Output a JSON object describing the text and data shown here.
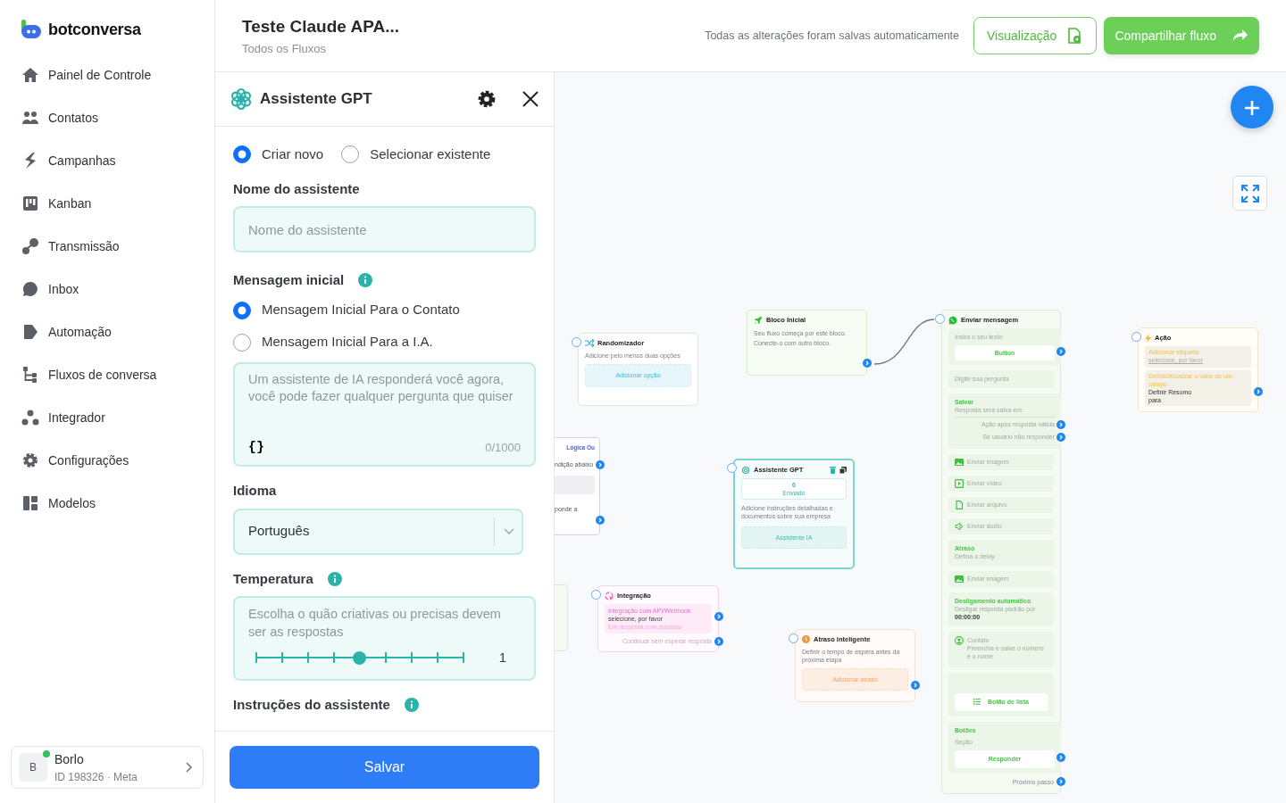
{
  "brand": {
    "name": "botconversa"
  },
  "sidebar": {
    "items": [
      {
        "label": "Painel de Controle"
      },
      {
        "label": "Contatos"
      },
      {
        "label": "Campanhas"
      },
      {
        "label": "Kanban"
      },
      {
        "label": "Transmissão"
      },
      {
        "label": "Inbox"
      },
      {
        "label": "Automação"
      },
      {
        "label": "Fluxos de conversa"
      },
      {
        "label": "Integrador"
      },
      {
        "label": "Configurações"
      },
      {
        "label": "Modelos"
      }
    ]
  },
  "user": {
    "initial": "B",
    "name": "Borlo",
    "meta": "ID 198326 · Meta",
    "online": true
  },
  "header": {
    "title": "Teste Claude APA...",
    "subtitle": "Todos os Fluxos",
    "save_status": "Todas as alterações foram salvas automaticamente",
    "buttons": [
      {
        "label": "Visualização",
        "kind": "outline"
      },
      {
        "label": "Compartilhar fluxo",
        "kind": "primary"
      }
    ]
  },
  "panel": {
    "title": "Assistente GPT",
    "mode_options": [
      {
        "label": "Criar novo",
        "selected": true
      },
      {
        "label": "Selecionar existente",
        "selected": false
      }
    ],
    "name_field": {
      "label": "Nome do assistente",
      "placeholder": "Nome do assistente"
    },
    "initial_message": {
      "label": "Mensagem inicial",
      "options": [
        {
          "label": "Mensagem Inicial Para o Contato",
          "selected": true
        },
        {
          "label": "Mensagem Inicial Para a I.A.",
          "selected": false
        }
      ],
      "placeholder": "Um assistente de IA responderá você agora, você pode fazer qualquer pergunta que quiser",
      "variable_button": "{}",
      "counter": "0/1000"
    },
    "language": {
      "label": "Idioma",
      "value": "Português"
    },
    "temperature": {
      "label": "Temperatura",
      "hint": "Escolha o quão criativas ou precisas devem ser as respostas",
      "level": 0.5,
      "reading": "1"
    },
    "instructions": {
      "label": "Instruções do assistente"
    },
    "save_button": "Salvar"
  },
  "canvas": {
    "nodes": [
      {
        "kind": "randomizer",
        "title": "Randomizador",
        "description": "Adicione pelo menos duas opções",
        "action": "Adicionar opção"
      },
      {
        "kind": "start",
        "title": "Bloco Inicial",
        "description": "Seu fluxo começa por este bloco. Conecte-o com outro bloco."
      },
      {
        "kind": "logic",
        "title": "Lógica Ou",
        "lines": [
          "ndição abaixo",
          "ponde a"
        ]
      },
      {
        "kind": "gpt",
        "title": "Assistente GPT",
        "count": "0",
        "count_label": "Enviado",
        "description": "Adicione instruções detalhadas e documentos sobre sua empresa",
        "action": "Assistente IA"
      },
      {
        "kind": "integration",
        "title": "Integração",
        "label": "Integração com API/Webhook",
        "value": "selecione, por favor",
        "note": "Em resposta com sucesso",
        "footer": "Continuar sem esperar resposta"
      },
      {
        "kind": "delay",
        "title": "Atraso inteligente",
        "description": "Definir o tempo de espera antes da próxima etapa",
        "action": "Adicionar atraso"
      },
      {
        "kind": "message",
        "title": "Enviar mensagem",
        "footer": "Próximo passo",
        "items": [
          {
            "kind": "text",
            "text": "Insira o seu texto",
            "button": "Button"
          },
          {
            "kind": "question",
            "text": "Digite sua pergunta"
          },
          {
            "kind": "save",
            "label": "Salvar",
            "text": "Resposta será salva em:",
            "outputs": [
              "Ação após resposta válida",
              "Se usuário não responder"
            ]
          },
          {
            "kind": "image",
            "text": "Enviar imagem"
          },
          {
            "kind": "video",
            "text": "Enviar vídeo"
          },
          {
            "kind": "file",
            "text": "Enviar arquivo"
          },
          {
            "kind": "audio",
            "text": "Enviar áudio"
          },
          {
            "kind": "delay",
            "label": "Atraso",
            "text": "Defina o delay"
          },
          {
            "kind": "image",
            "text": "Enviar imagem"
          },
          {
            "kind": "shutdown",
            "label": "Desligamento automático",
            "text": "Desligar resposta padrão por",
            "value": "00:00:00"
          },
          {
            "kind": "contact",
            "title": "Contato",
            "text": "Preencha e salve o número e o nome"
          },
          {
            "kind": "list",
            "button": "Botão de lista"
          },
          {
            "kind": "buttons",
            "label": "Botões",
            "text": "Seção",
            "button": "Responder"
          }
        ]
      },
      {
        "kind": "action",
        "title": "Ação",
        "fields": [
          {
            "kind": "tag",
            "label": "Adicionar etiqueta",
            "placeholder": "selecione, por favor"
          },
          {
            "kind": "field",
            "label": "Definir/Atualizar o valor de um campo",
            "value": "Definir Resumo para"
          }
        ]
      },
      {
        "kind": "stub"
      }
    ]
  }
}
